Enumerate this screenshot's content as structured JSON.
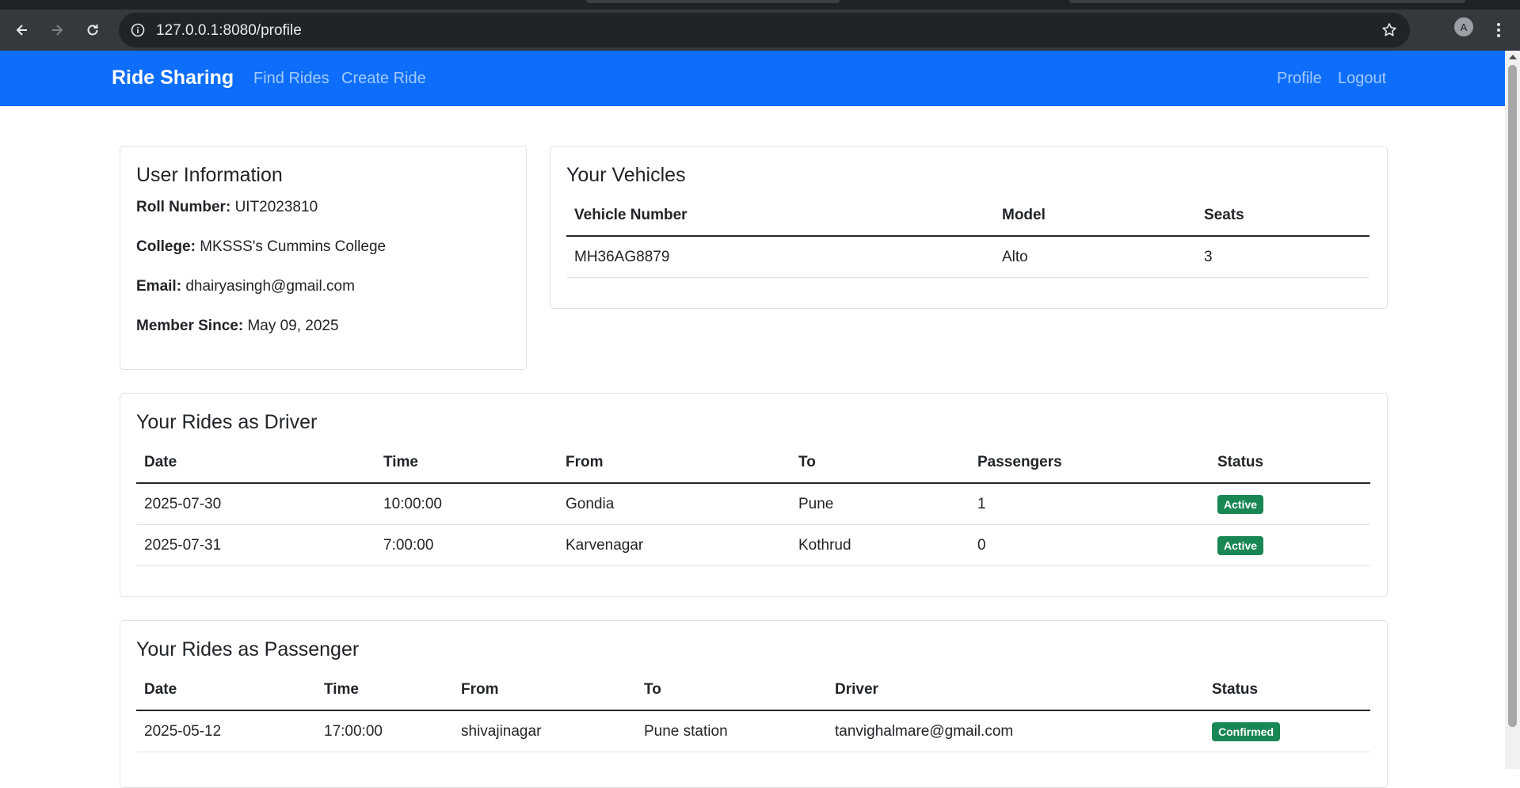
{
  "browser": {
    "url": "127.0.0.1:8080/profile",
    "profile_initial": "A"
  },
  "navbar": {
    "brand": "Ride Sharing",
    "links": [
      "Find Rides",
      "Create Ride"
    ],
    "right_links": [
      "Profile",
      "Logout"
    ]
  },
  "user_info": {
    "title": "User Information",
    "roll_label": "Roll Number:",
    "roll_value": "UIT2023810",
    "college_label": "College:",
    "college_value": "MKSSS's Cummins College",
    "email_label": "Email:",
    "email_value": "dhairyasingh@gmail.com",
    "since_label": "Member Since:",
    "since_value": "May 09, 2025"
  },
  "vehicles": {
    "title": "Your Vehicles",
    "headers": [
      "Vehicle Number",
      "Model",
      "Seats"
    ],
    "rows": [
      [
        "MH36AG8879",
        "Alto",
        "3"
      ]
    ]
  },
  "driver_rides": {
    "title": "Your Rides as Driver",
    "headers": [
      "Date",
      "Time",
      "From",
      "To",
      "Passengers",
      "Status"
    ],
    "rows": [
      [
        "2025-07-30",
        "10:00:00",
        "Gondia",
        "Pune",
        "1",
        "Active"
      ],
      [
        "2025-07-31",
        "7:00:00",
        "Karvenagar",
        "Kothrud",
        "0",
        "Active"
      ]
    ]
  },
  "passenger_rides": {
    "title": "Your Rides as Passenger",
    "headers": [
      "Date",
      "Time",
      "From",
      "To",
      "Driver",
      "Status"
    ],
    "rows": [
      [
        "2025-05-12",
        "17:00:00",
        "shivajinagar",
        "Pune station",
        "tanvighalmare@gmail.com",
        "Confirmed"
      ]
    ]
  },
  "colors": {
    "primary": "#0d6efd",
    "success": "#198754"
  }
}
